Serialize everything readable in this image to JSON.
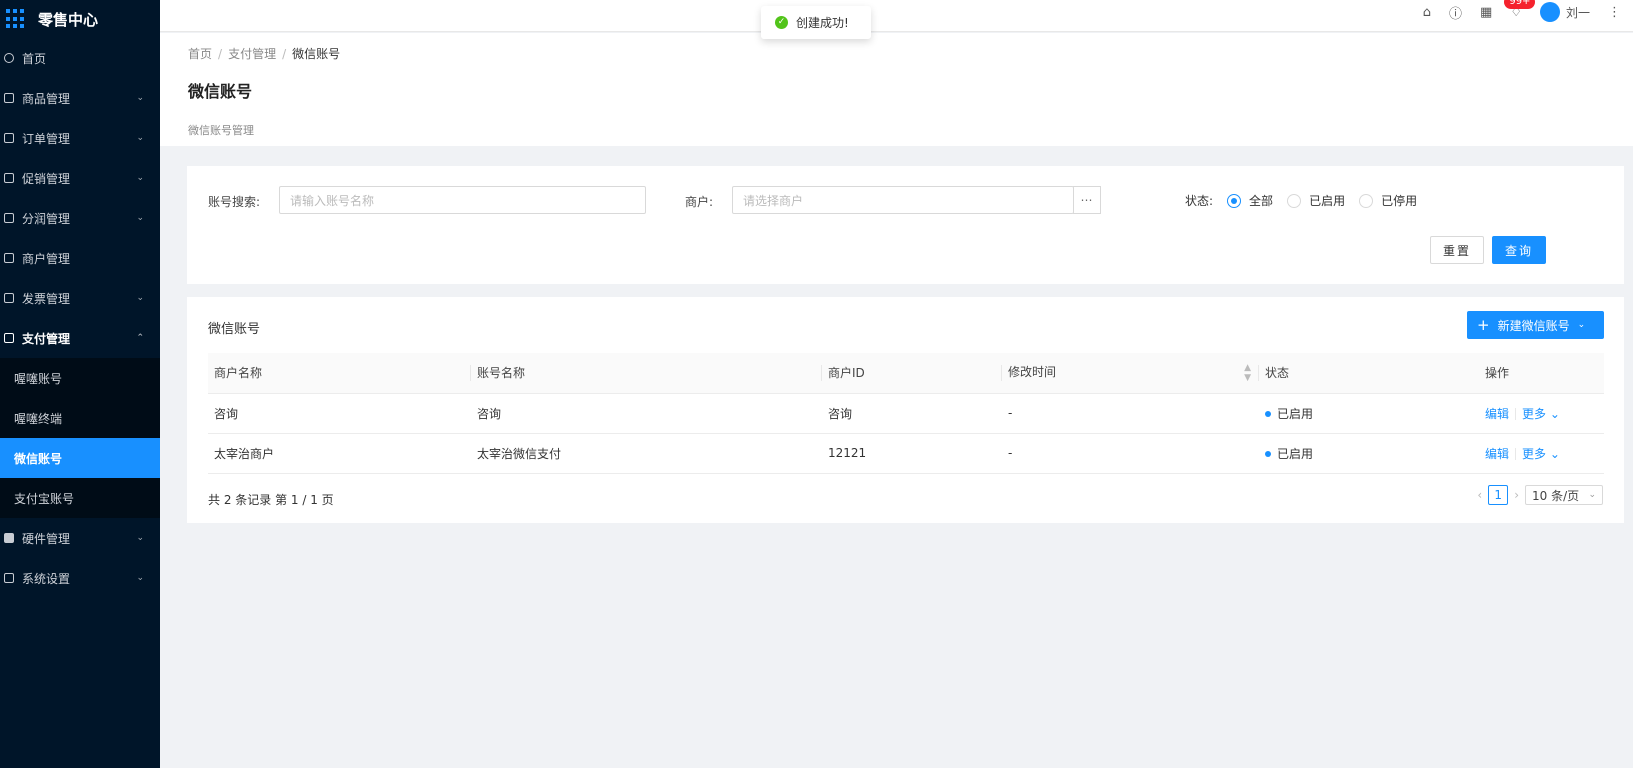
{
  "app": {
    "title": "零售中心"
  },
  "sidebar": {
    "items": [
      {
        "label": "首页",
        "has_children": false
      },
      {
        "label": "商品管理",
        "has_children": true
      },
      {
        "label": "订单管理",
        "has_children": true
      },
      {
        "label": "促销管理",
        "has_children": true
      },
      {
        "label": "分润管理",
        "has_children": true
      },
      {
        "label": "商户管理",
        "has_children": false
      },
      {
        "label": "发票管理",
        "has_children": true
      },
      {
        "label": "支付管理",
        "has_children": true,
        "open": true
      },
      {
        "label": "硬件管理",
        "has_children": true
      },
      {
        "label": "系统设置",
        "has_children": true
      }
    ],
    "submenu": [
      {
        "label": "喔噻账号"
      },
      {
        "label": "喔噻终端"
      },
      {
        "label": "微信账号",
        "active": true
      },
      {
        "label": "支付宝账号"
      }
    ]
  },
  "header": {
    "notification_count": "99+",
    "user_name": "刘一"
  },
  "toast": {
    "message": "创建成功!"
  },
  "breadcrumb": [
    "首页",
    "支付管理",
    "微信账号"
  ],
  "page": {
    "title": "微信账号",
    "description": "微信账号管理"
  },
  "filter": {
    "account_label": "账号搜索:",
    "account_placeholder": "请输入账号名称",
    "merchant_label": "商户:",
    "merchant_placeholder": "请选择商户",
    "status_label": "状态:",
    "status_options": [
      "全部",
      "已启用",
      "已停用"
    ],
    "status_selected": "全部",
    "reset_label": "重置",
    "query_label": "查询"
  },
  "table": {
    "title": "微信账号",
    "new_button": "新建微信账号",
    "columns": [
      "商户名称",
      "账号名称",
      "商户ID",
      "修改时间",
      "状态",
      "操作"
    ],
    "rows": [
      {
        "merchant": "咨询",
        "account": "咨询",
        "merchant_id": "咨询",
        "modified": "-",
        "status": "已启用",
        "edit": "编辑",
        "more": "更多"
      },
      {
        "merchant": "太宰治商户",
        "account": "太宰治微信支付",
        "merchant_id": "12121",
        "modified": "-",
        "status": "已启用",
        "edit": "编辑",
        "more": "更多"
      }
    ],
    "total_text": "共 2 条记录 第 1 / 1 页",
    "current_page": "1",
    "page_size": "10 条/页"
  },
  "colors": {
    "primary": "#1890ff",
    "sidebar_bg": "#001529",
    "success": "#52c41a",
    "badge": "#f5222d"
  }
}
